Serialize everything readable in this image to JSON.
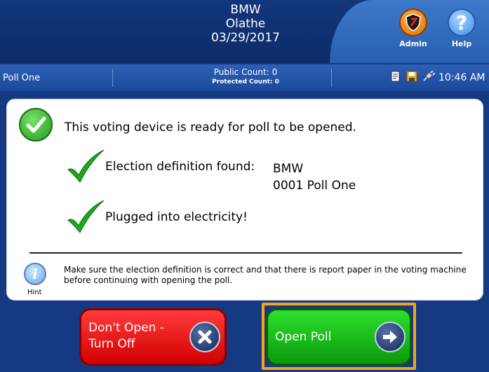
{
  "header": {
    "line1": "BMW",
    "line2": "Olathe",
    "line3": "03/29/2017",
    "admin_label": "Admin",
    "help_label": "Help",
    "help_glyph": "?"
  },
  "status": {
    "poll_name": "Poll One",
    "public_count": "Public Count: 0",
    "protected_count": "Protected Count: 0",
    "time": "10:46 AM"
  },
  "main": {
    "ready_text": "This voting device is ready for poll to be opened.",
    "election_label": "Election definition found:",
    "election_name": "BMW",
    "election_poll": "0001 Poll One",
    "power_text": "Plugged into electricity!",
    "hint_glyph": "i",
    "hint_label": "Hint",
    "hint_text": "Make sure the election definition is correct and that there is report paper in the voting machine before continuing with opening the poll."
  },
  "buttons": {
    "dont_open_line1": "Don't Open -",
    "dont_open_line2": "Turn Off",
    "open_poll": "Open Poll"
  },
  "colors": {
    "background": "#163a82",
    "accent_highlight": "#f6a31b",
    "dont_open": "#e01010",
    "open_poll": "#1cc41c"
  }
}
